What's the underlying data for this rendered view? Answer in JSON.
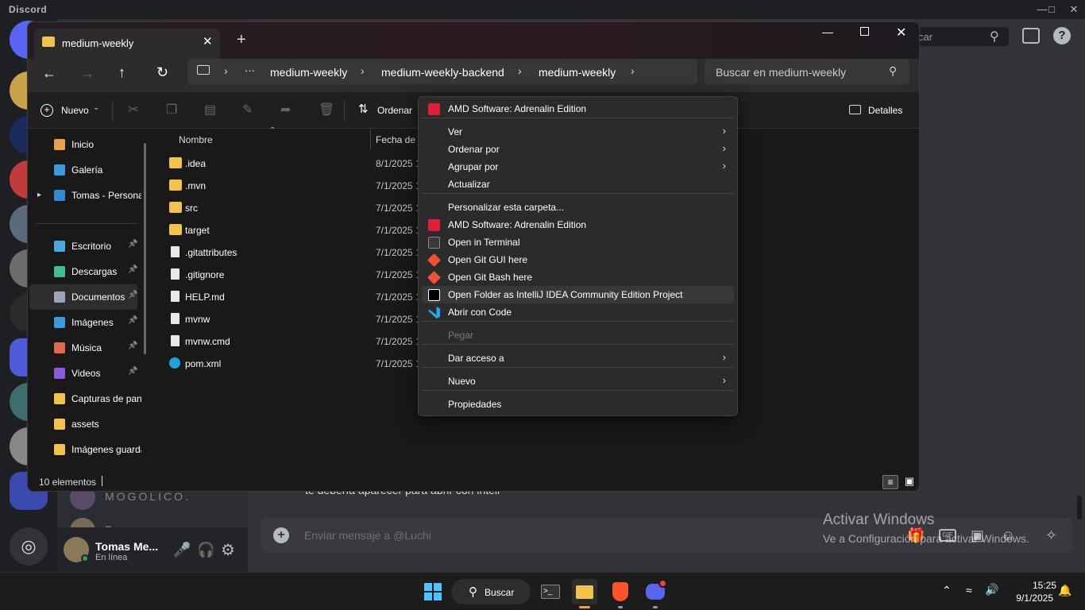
{
  "discord": {
    "app_title": "Discord",
    "search_placeholder": "car",
    "dm_name_1": "MOGOLICO.",
    "dm_name_2": "Franco",
    "chat_partial_text": "te debería aparecer para abrir con intell",
    "message_placeholder": "Enviar mensaje a @Luchi",
    "user_name": "Tomas Me...",
    "user_status": "En línea"
  },
  "watermark": {
    "line1": "Activar Windows",
    "line2": "Ve a Configuración para activar Windows."
  },
  "explorer": {
    "tab_title": "medium-weekly",
    "new_tab_label": "+",
    "breadcrumb": [
      "medium-weekly",
      "medium-weekly-backend",
      "medium-weekly"
    ],
    "breadcrumb_more": "···",
    "search_placeholder": "Buscar en medium-weekly",
    "toolbar": {
      "new_label": "Nuevo",
      "sort_label": "Ordenar",
      "details_label": "Detalles"
    },
    "columns": {
      "name": "Nombre",
      "date": "Fecha de m"
    },
    "nav_items": [
      {
        "label": "Inicio",
        "icon": "home-icon",
        "pinned": false
      },
      {
        "label": "Galería",
        "icon": "gallery-icon",
        "pinned": false
      },
      {
        "label": "Tomas - Personal",
        "icon": "onedrive-icon",
        "pinned": false
      },
      {
        "label": "Escritorio",
        "icon": "desktop-icon",
        "pinned": true
      },
      {
        "label": "Descargas",
        "icon": "downloads-icon",
        "pinned": true
      },
      {
        "label": "Documentos",
        "icon": "documents-icon",
        "pinned": true
      },
      {
        "label": "Imágenes",
        "icon": "pictures-icon",
        "pinned": true
      },
      {
        "label": "Música",
        "icon": "music-icon",
        "pinned": true
      },
      {
        "label": "Videos",
        "icon": "videos-icon",
        "pinned": true
      },
      {
        "label": "Capturas de pantalla",
        "icon": "folder-icon",
        "pinned": false
      },
      {
        "label": "assets",
        "icon": "folder-icon",
        "pinned": false
      },
      {
        "label": "Imágenes guardadas",
        "icon": "folder-icon",
        "pinned": false
      }
    ],
    "files": [
      {
        "name": ".idea",
        "date": "8/1/2025 1",
        "type": "folder"
      },
      {
        "name": ".mvn",
        "date": "7/1/2025 1",
        "type": "folder"
      },
      {
        "name": "src",
        "date": "7/1/2025 1",
        "type": "folder"
      },
      {
        "name": "target",
        "date": "7/1/2025 1",
        "type": "folder"
      },
      {
        "name": ".gitattributes",
        "date": "7/1/2025 1",
        "type": "file"
      },
      {
        "name": ".gitignore",
        "date": "7/1/2025 1",
        "type": "file"
      },
      {
        "name": "HELP.md",
        "date": "7/1/2025 1",
        "type": "file"
      },
      {
        "name": "mvnw",
        "date": "7/1/2025 1",
        "type": "file"
      },
      {
        "name": "mvnw.cmd",
        "date": "7/1/2025 1",
        "type": "file"
      },
      {
        "name": "pom.xml",
        "date": "7/1/2025 1",
        "type": "edge"
      }
    ],
    "status_count": "10 elementos"
  },
  "context_menu": {
    "items": [
      {
        "label": "AMD Software: Adrenalin Edition",
        "icon": "amd-icon"
      },
      {
        "label": "Ver",
        "submenu": true
      },
      {
        "label": "Ordenar por",
        "submenu": true
      },
      {
        "label": "Agrupar por",
        "submenu": true
      },
      {
        "label": "Actualizar"
      },
      {
        "label": "Personalizar esta carpeta..."
      },
      {
        "label": "AMD Software: Adrenalin Edition",
        "icon": "amd-icon"
      },
      {
        "label": "Open in Terminal",
        "icon": "terminal-icon"
      },
      {
        "label": "Open Git GUI here",
        "icon": "git-icon"
      },
      {
        "label": "Open Git Bash here",
        "icon": "git-icon"
      },
      {
        "label": "Open Folder as IntelliJ IDEA Community Edition Project",
        "icon": "intellij-icon",
        "highlighted": true
      },
      {
        "label": "Abrir con Code",
        "icon": "vscode-icon"
      },
      {
        "label": "Pegar",
        "disabled": true
      },
      {
        "label": "Dar acceso a",
        "submenu": true
      },
      {
        "label": "Nuevo",
        "submenu": true
      },
      {
        "label": "Propiedades"
      }
    ]
  },
  "taskbar": {
    "search_label": "Buscar",
    "time": "15:25",
    "date": "9/1/2025"
  },
  "colors": {
    "accent": "#5865f2",
    "folder": "#f3c24a",
    "amd": "#e01e37",
    "vscode": "#23a9f2"
  }
}
